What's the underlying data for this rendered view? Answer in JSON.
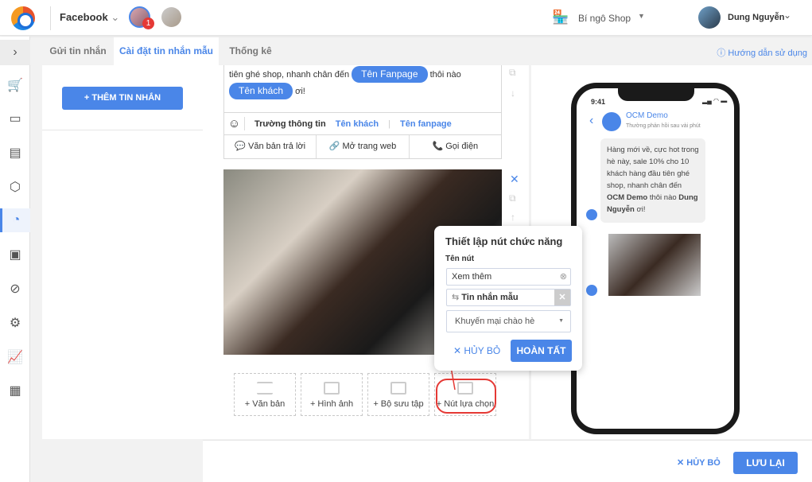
{
  "header": {
    "channel": "Facebook",
    "badge_count": "1",
    "shop": "Bí ngô Shop",
    "user": "Dung Nguyễn"
  },
  "tabs": [
    "Gửi tin nhắn",
    "Cài đặt tin nhắn mẫu",
    "Thống kê"
  ],
  "help": "Hướng dẫn sử dụng",
  "left": {
    "add_button": "+ THÊM TIN NHẮN"
  },
  "editor": {
    "text_line1": "tiên ghé shop, nhanh chân đến",
    "tag_fanpage": "Tên Fanpage",
    "text_line1_end": "thôi nào",
    "tag_customer": "Tên khách",
    "text_line2_end": "ơi!",
    "field_label": "Trường thông tin",
    "field_customer": "Tên khách",
    "field_sep": "|",
    "field_fanpage": "Tên fanpage",
    "actions": [
      "Văn bản trả lời",
      "Mở trang web",
      "Gọi điện"
    ]
  },
  "add_blocks": [
    "+ Văn bản",
    "+ Hình ảnh",
    "+ Bộ sưu tập",
    "+ Nút lựa chọn"
  ],
  "popup": {
    "title": "Thiết lập nút chức năng",
    "name_label": "Tên nút",
    "name_value": "Xem thêm",
    "type": "Tin nhắn mẫu",
    "template": "Khuyến mại chào hè",
    "cancel": "HỦY BỎ",
    "done": "HOÀN TẤT"
  },
  "phone": {
    "time": "9:41",
    "page": "OCM Demo",
    "subtitle": "Thường phản hồi sau vài phút",
    "msg_part1": "Hàng mới về, cực hot trong hè này, sale 10% cho 10 khách hàng đầu tiên ghé shop, nhanh chân đến ",
    "msg_page": "OCM Demo",
    "msg_part2": " thôi nào ",
    "msg_user": "Dung Nguyễn",
    "msg_part3": " ơi!"
  },
  "footer": {
    "cancel": "✕ HỦY BỎ",
    "save": "LƯU LẠI"
  },
  "colors": {
    "accent": "#4a86e8",
    "highlight": "#e53935"
  }
}
